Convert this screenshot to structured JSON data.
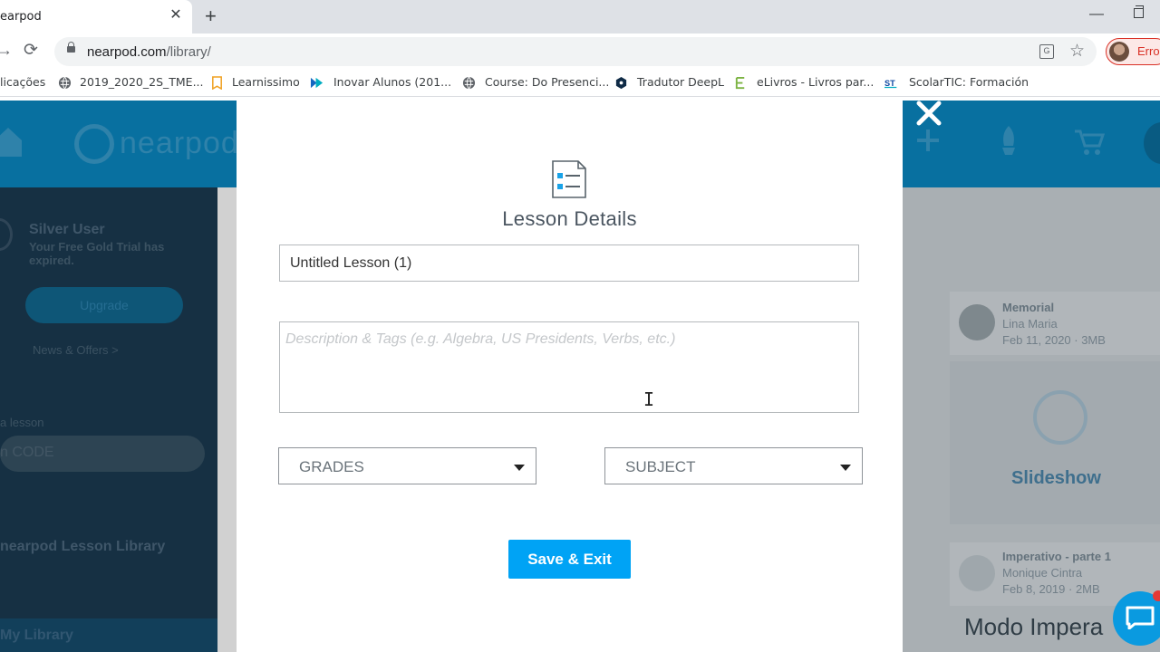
{
  "browser": {
    "tab_title": "earpod",
    "tab_close": "✕",
    "new_tab": "+",
    "url_host": "nearpod.com",
    "url_path": "/library/",
    "profile_label": "Erro",
    "bookmarks": [
      {
        "label": "licações"
      },
      {
        "label": "2019_2020_2S_TME..."
      },
      {
        "label": "Learnissimo"
      },
      {
        "label": "Inovar Alunos (201..."
      },
      {
        "label": "Course: Do Presenci..."
      },
      {
        "label": "Tradutor DeepL"
      },
      {
        "label": "eLivros - Livros par..."
      },
      {
        "label": "ScolarTIC: Formación"
      }
    ]
  },
  "background": {
    "logo": "nearpod",
    "user_level": "Silver User",
    "trial_line1": "Your Free Gold Trial has",
    "trial_line2": "expired.",
    "upgrade": "Upgrade",
    "news": "News & Offers >",
    "join_label": "a lesson",
    "code_placeholder": "n CODE",
    "library_link": "nearpod Lesson Library",
    "my_library": "My Library",
    "card1_title": "Memorial",
    "card1_author": "Lina Maria",
    "card1_date": "Feb 11, 2020 · 3MB",
    "slideshow": "Slideshow",
    "card2_title": "Imperativo - parte 1",
    "card2_author": "Monique Cintra",
    "card2_date": "Feb 8, 2019 · 2MB",
    "card2_heading": "Modo Impera"
  },
  "modal": {
    "title": "Lesson Details",
    "lesson_name": "Untitled Lesson (1)",
    "description_placeholder": "Description & Tags (e.g. Algebra, US Presidents, Verbs, etc.)",
    "grades": "GRADES",
    "subject": "SUBJECT",
    "save_exit": "Save & Exit"
  },
  "colors": {
    "accent": "#00a3f5",
    "header_blue": "#0a89c4",
    "dark_panel": "#1b3b52"
  }
}
